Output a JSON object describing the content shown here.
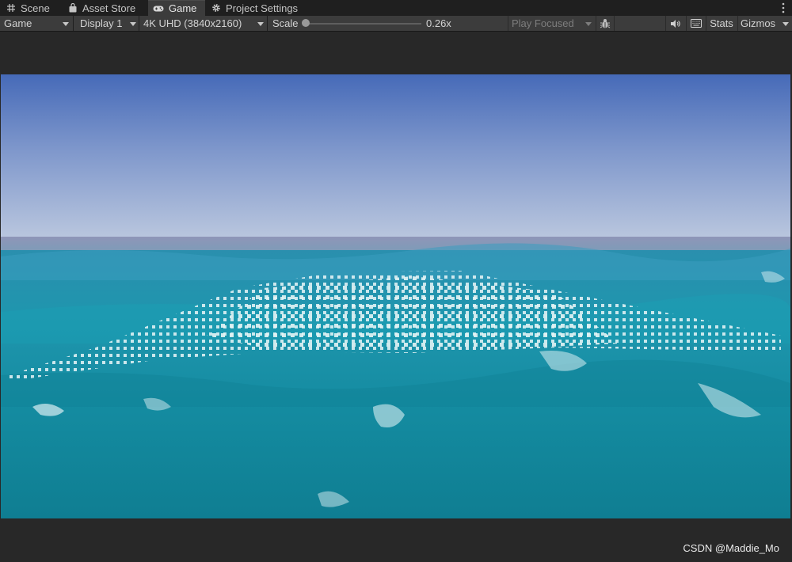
{
  "tabs": [
    {
      "label": "Scene",
      "icon": "grid-icon"
    },
    {
      "label": "Asset Store",
      "icon": "bag-icon"
    },
    {
      "label": "Game",
      "icon": "gamepad-icon"
    },
    {
      "label": "Project Settings",
      "icon": "gear-icon"
    }
  ],
  "toolbar": {
    "view_mode": "Game",
    "display": "Display 1",
    "resolution": "4K UHD (3840x2160)",
    "scale_label": "Scale",
    "scale_value": "0.26x",
    "play_mode": "Play Focused",
    "stats": "Stats",
    "gizmos": "Gizmos"
  },
  "watermark": "CSDN @Maddie_Mo",
  "colors": {
    "sky_top": "#4a6dbb",
    "sky_horizon": "#b6c4dd",
    "sea": "#1e8fa3",
    "sea_dark": "#0f7387"
  }
}
